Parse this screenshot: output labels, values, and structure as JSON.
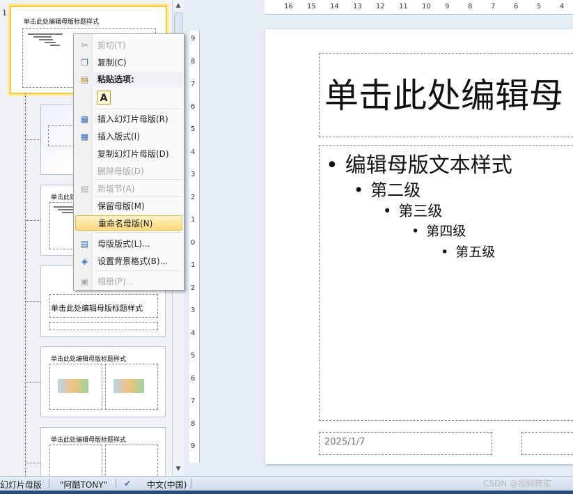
{
  "thumbnails": {
    "slide_number": "1",
    "master_title": "单击此处编辑母版标题样式",
    "layout_titles": [
      "单击此处编辑母版标题样式",
      "单击此处编辑母版标题样式",
      "单击此处编辑母版标题样式",
      "单击此处编辑母版标题样式"
    ]
  },
  "ruler": {
    "h_labels": [
      "16",
      "15",
      "14",
      "13",
      "12",
      "11",
      "10",
      "9",
      "8",
      "7",
      "6",
      "5",
      "4"
    ],
    "v_labels": [
      "9",
      "8",
      "7",
      "6",
      "5",
      "4",
      "3",
      "2",
      "1",
      "0",
      "1",
      "2",
      "3",
      "4",
      "5",
      "6",
      "7",
      "8",
      "9"
    ]
  },
  "slide": {
    "title": "单击此处编辑母",
    "levels": [
      "编辑母版文本样式",
      "第二级",
      "第三级",
      "第四级",
      "第五级"
    ],
    "date": "2025/1/7"
  },
  "context_menu": {
    "cut": "剪切(T)",
    "copy": "复制(C)",
    "paste_options": "粘贴选项:",
    "paste_a": "A",
    "insert_master": "插入幻灯片母版(R)",
    "insert_layout": "插入版式(I)",
    "duplicate_master": "复制幻灯片母版(D)",
    "delete_master": "删除母版(D)",
    "add_section": "新增节(A)",
    "preserve_master": "保留母版(M)",
    "rename_master": "重命名母版(N)",
    "master_layout": "母版版式(L)...",
    "format_background": "设置背景格式(B)...",
    "photo_album": "相册(P)..."
  },
  "status_bar": {
    "view": "幻灯片母版",
    "theme": "\"阿酷TONY\"",
    "language": "中文(中国)"
  },
  "watermark": "CSDN @视频砖家",
  "colors": {
    "highlight": "#f9d97a",
    "selected_border": "#f5c842"
  }
}
